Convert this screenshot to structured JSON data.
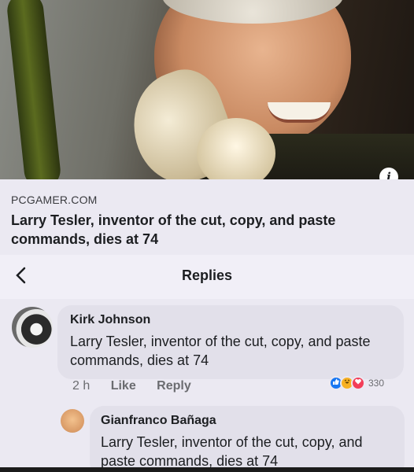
{
  "link_preview": {
    "info_icon": "info-icon",
    "domain": "PCGAMER.COM",
    "headline": "Larry Tesler, inventor of the cut, copy, and paste commands, dies at 74"
  },
  "replies_header": {
    "back_icon": "chevron-left-icon",
    "title": "Replies"
  },
  "comments": [
    {
      "author": "Kirk Johnson",
      "text": "Larry Tesler, inventor of the cut, copy, and paste commands, dies at 74",
      "time": "2 h",
      "like_label": "Like",
      "reply_label": "Reply",
      "reaction_icons": [
        "like-reaction-icon",
        "haha-reaction-icon",
        "love-reaction-icon"
      ],
      "reaction_count": "330"
    },
    {
      "author": "Gianfranco Bañaga",
      "text": "Larry Tesler, inventor of the cut, copy, and paste commands, dies at 74"
    }
  ],
  "colors": {
    "like": "#1877f2",
    "haha": "#f7b125",
    "love": "#f33e58",
    "background": "#ebe9f2"
  }
}
